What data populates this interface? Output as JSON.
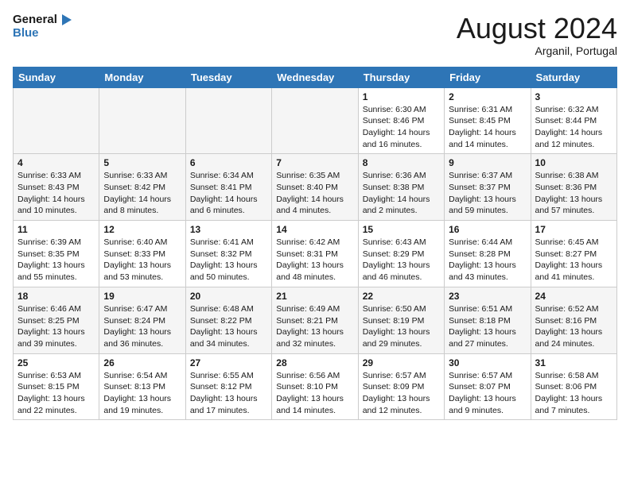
{
  "header": {
    "logo_line1": "General",
    "logo_line2": "Blue",
    "month_title": "August 2024",
    "location": "Arganil, Portugal"
  },
  "weekdays": [
    "Sunday",
    "Monday",
    "Tuesday",
    "Wednesday",
    "Thursday",
    "Friday",
    "Saturday"
  ],
  "weeks": [
    [
      {
        "day": "",
        "detail": ""
      },
      {
        "day": "",
        "detail": ""
      },
      {
        "day": "",
        "detail": ""
      },
      {
        "day": "",
        "detail": ""
      },
      {
        "day": "1",
        "detail": "Sunrise: 6:30 AM\nSunset: 8:46 PM\nDaylight: 14 hours\nand 16 minutes."
      },
      {
        "day": "2",
        "detail": "Sunrise: 6:31 AM\nSunset: 8:45 PM\nDaylight: 14 hours\nand 14 minutes."
      },
      {
        "day": "3",
        "detail": "Sunrise: 6:32 AM\nSunset: 8:44 PM\nDaylight: 14 hours\nand 12 minutes."
      }
    ],
    [
      {
        "day": "4",
        "detail": "Sunrise: 6:33 AM\nSunset: 8:43 PM\nDaylight: 14 hours\nand 10 minutes."
      },
      {
        "day": "5",
        "detail": "Sunrise: 6:33 AM\nSunset: 8:42 PM\nDaylight: 14 hours\nand 8 minutes."
      },
      {
        "day": "6",
        "detail": "Sunrise: 6:34 AM\nSunset: 8:41 PM\nDaylight: 14 hours\nand 6 minutes."
      },
      {
        "day": "7",
        "detail": "Sunrise: 6:35 AM\nSunset: 8:40 PM\nDaylight: 14 hours\nand 4 minutes."
      },
      {
        "day": "8",
        "detail": "Sunrise: 6:36 AM\nSunset: 8:38 PM\nDaylight: 14 hours\nand 2 minutes."
      },
      {
        "day": "9",
        "detail": "Sunrise: 6:37 AM\nSunset: 8:37 PM\nDaylight: 13 hours\nand 59 minutes."
      },
      {
        "day": "10",
        "detail": "Sunrise: 6:38 AM\nSunset: 8:36 PM\nDaylight: 13 hours\nand 57 minutes."
      }
    ],
    [
      {
        "day": "11",
        "detail": "Sunrise: 6:39 AM\nSunset: 8:35 PM\nDaylight: 13 hours\nand 55 minutes."
      },
      {
        "day": "12",
        "detail": "Sunrise: 6:40 AM\nSunset: 8:33 PM\nDaylight: 13 hours\nand 53 minutes."
      },
      {
        "day": "13",
        "detail": "Sunrise: 6:41 AM\nSunset: 8:32 PM\nDaylight: 13 hours\nand 50 minutes."
      },
      {
        "day": "14",
        "detail": "Sunrise: 6:42 AM\nSunset: 8:31 PM\nDaylight: 13 hours\nand 48 minutes."
      },
      {
        "day": "15",
        "detail": "Sunrise: 6:43 AM\nSunset: 8:29 PM\nDaylight: 13 hours\nand 46 minutes."
      },
      {
        "day": "16",
        "detail": "Sunrise: 6:44 AM\nSunset: 8:28 PM\nDaylight: 13 hours\nand 43 minutes."
      },
      {
        "day": "17",
        "detail": "Sunrise: 6:45 AM\nSunset: 8:27 PM\nDaylight: 13 hours\nand 41 minutes."
      }
    ],
    [
      {
        "day": "18",
        "detail": "Sunrise: 6:46 AM\nSunset: 8:25 PM\nDaylight: 13 hours\nand 39 minutes."
      },
      {
        "day": "19",
        "detail": "Sunrise: 6:47 AM\nSunset: 8:24 PM\nDaylight: 13 hours\nand 36 minutes."
      },
      {
        "day": "20",
        "detail": "Sunrise: 6:48 AM\nSunset: 8:22 PM\nDaylight: 13 hours\nand 34 minutes."
      },
      {
        "day": "21",
        "detail": "Sunrise: 6:49 AM\nSunset: 8:21 PM\nDaylight: 13 hours\nand 32 minutes."
      },
      {
        "day": "22",
        "detail": "Sunrise: 6:50 AM\nSunset: 8:19 PM\nDaylight: 13 hours\nand 29 minutes."
      },
      {
        "day": "23",
        "detail": "Sunrise: 6:51 AM\nSunset: 8:18 PM\nDaylight: 13 hours\nand 27 minutes."
      },
      {
        "day": "24",
        "detail": "Sunrise: 6:52 AM\nSunset: 8:16 PM\nDaylight: 13 hours\nand 24 minutes."
      }
    ],
    [
      {
        "day": "25",
        "detail": "Sunrise: 6:53 AM\nSunset: 8:15 PM\nDaylight: 13 hours\nand 22 minutes."
      },
      {
        "day": "26",
        "detail": "Sunrise: 6:54 AM\nSunset: 8:13 PM\nDaylight: 13 hours\nand 19 minutes."
      },
      {
        "day": "27",
        "detail": "Sunrise: 6:55 AM\nSunset: 8:12 PM\nDaylight: 13 hours\nand 17 minutes."
      },
      {
        "day": "28",
        "detail": "Sunrise: 6:56 AM\nSunset: 8:10 PM\nDaylight: 13 hours\nand 14 minutes."
      },
      {
        "day": "29",
        "detail": "Sunrise: 6:57 AM\nSunset: 8:09 PM\nDaylight: 13 hours\nand 12 minutes."
      },
      {
        "day": "30",
        "detail": "Sunrise: 6:57 AM\nSunset: 8:07 PM\nDaylight: 13 hours\nand 9 minutes."
      },
      {
        "day": "31",
        "detail": "Sunrise: 6:58 AM\nSunset: 8:06 PM\nDaylight: 13 hours\nand 7 minutes."
      }
    ]
  ]
}
